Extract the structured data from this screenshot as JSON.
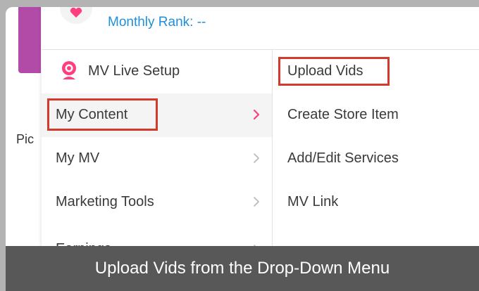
{
  "header": {
    "rank_label": "Monthly Rank: --"
  },
  "page": {
    "fragment_text": "Pic"
  },
  "menu": {
    "items": [
      {
        "label": "MV Live Setup",
        "icon": "webcam-icon",
        "has_chevron": false
      },
      {
        "label": "My Content",
        "has_chevron": true,
        "active": true
      },
      {
        "label": "My MV",
        "has_chevron": true
      },
      {
        "label": "Marketing Tools",
        "has_chevron": true
      },
      {
        "label": "Earnings",
        "has_chevron": true
      }
    ]
  },
  "submenu": {
    "items": [
      {
        "label": "Upload Vids",
        "highlighted": true
      },
      {
        "label": "Create Store Item"
      },
      {
        "label": "Add/Edit Services"
      },
      {
        "label": "MV Link"
      }
    ]
  },
  "caption": {
    "text": "Upload Vids from the Drop-Down Menu"
  },
  "colors": {
    "accent_pink": "#ff3d7f",
    "link_blue": "#1e8fdc",
    "highlight_red": "#d33a2c",
    "caption_bg": "#585858",
    "sidebar_purple": "#b24aa8"
  }
}
